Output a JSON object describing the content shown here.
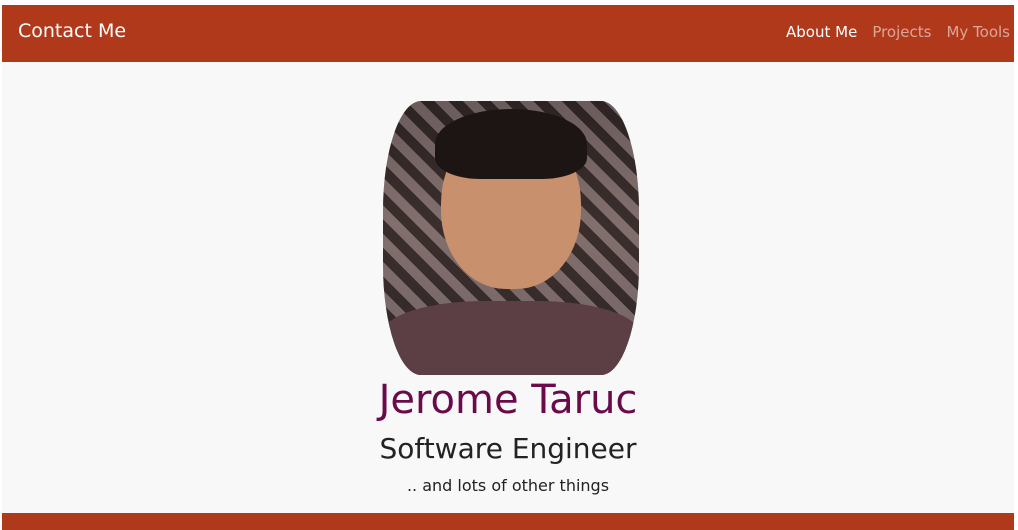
{
  "navbar": {
    "brand": "Contact Me",
    "links": [
      "About Me",
      "Projects",
      "My Tools"
    ],
    "active": "About Me"
  },
  "profile": {
    "name": "Jerome Taruc",
    "title": "Software Engineer",
    "tagline": ".. and lots of other things"
  },
  "colors": {
    "accent": "#b0391c",
    "name": "#6b0a4b",
    "background": "#f8f8f8"
  }
}
